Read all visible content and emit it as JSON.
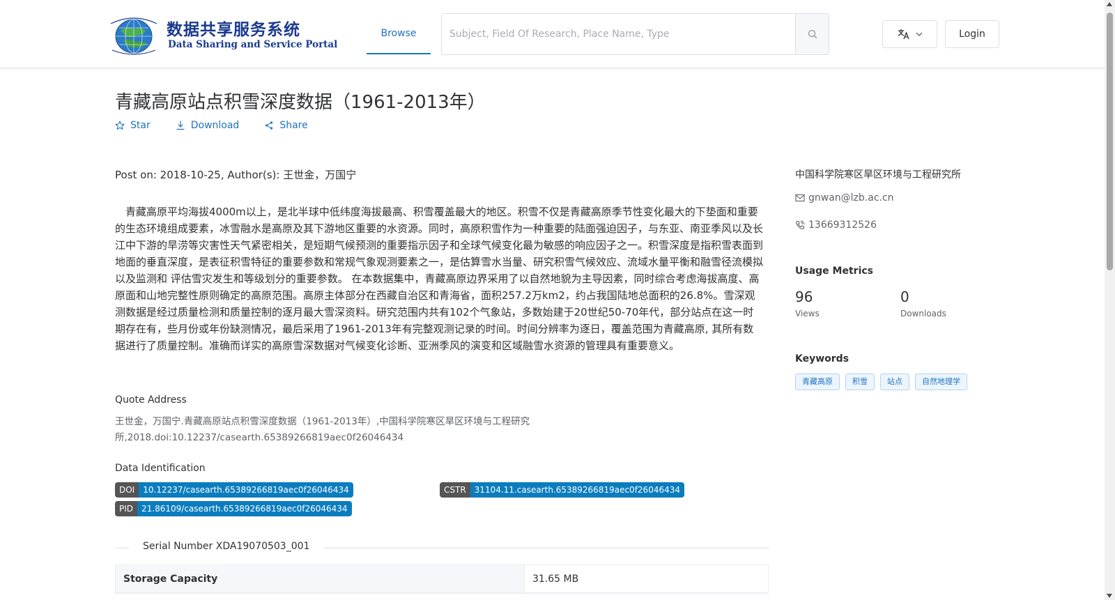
{
  "header": {
    "logo_cn": "数据共享服务系统",
    "logo_en": "Data Sharing and Service Portal",
    "nav_browse": "Browse",
    "search_placeholder": "Subject, Field Of Research, Place Name, Type",
    "login_label": "Login"
  },
  "dataset": {
    "title": "青藏高原站点积雪深度数据（1961-2013年）",
    "actions": {
      "star": "Star",
      "download": "Download",
      "share": "Share"
    },
    "post_info": "Post on: 2018-10-25, Author(s): 王世金，万国宁",
    "description": "青藏高原平均海拔4000m以上，是北半球中低纬度海拔最高、积雪覆盖最大的地区。积雪不仅是青藏高原季节性变化最大的下垫面和重要的生态环境组成要素，冰雪融水是高原及其下游地区重要的水资源。同时，高原积雪作为一种重要的陆面强迫因子，与东亚、南亚季风以及长江中下游的旱涝等灾害性天气紧密相关，是短期气候预测的重要指示因子和全球气候变化最为敏感的响应因子之一。积雪深度是指积雪表面到地面的垂直深度，是表征积雪特征的重要参数和常规气象观测要素之一，是估算雪水当量、研究积雪气候效应、流域水量平衡和融雪径流模拟以及监测和 评估雪灾发生和等级划分的重要参数。 在本数据集中，青藏高原边界采用了以自然地貌为主导因素，同时综合考虑海拔高度、高原面和山地完整性原则确定的高原范围。高原主体部分在西藏自治区和青海省，面积257.2万km2，约占我国陆地总面积的26.8%。雪深观测数据是经过质量检测和质量控制的逐月最大雪深资料。研究范围内共有102个气象站，多数始建于20世纪50-70年代，部分站点在这一时期存在有，些月份或年份缺测情况，最后采用了1961-2013年有完整观测记录的时间。时间分辨率为逐日，覆盖范围为青藏高原, 其所有数据进行了质量控制。准确而详实的高原雪深数据对气候变化诊断、亚洲季风的演变和区域融雪水资源的管理具有重要意义。",
    "quote_label": "Quote Address",
    "quote_text": "王世金，万国宁.青藏高原站点积雪深度数据（1961-2013年）,中国科学院寒区旱区环境与工程研究所,2018.doi:10.12237/casearth.65389266819aec0f26046434",
    "data_id_label": "Data Identification",
    "identifiers": {
      "doi_key": "DOI",
      "doi_value": "10.12237/casearth.65389266819aec0f26046434",
      "cstr_key": "CSTR",
      "cstr_value": "31104.11.casearth.65389266819aec0f26046434",
      "pid_key": "PID",
      "pid_value": "21.86109/casearth.65389266819aec0f26046434"
    },
    "serial_number": "Serial Number XDA19070503_001",
    "table": [
      {
        "key": "Storage Capacity",
        "value": "31.65 MB"
      }
    ]
  },
  "sidebar": {
    "organization": "中国科学院寒区旱区环境与工程研究所",
    "email": "gnwan@lzb.ac.cn",
    "phone": "13669312526",
    "usage_title": "Usage Metrics",
    "views_count": "96",
    "views_label": "Views",
    "downloads_count": "0",
    "downloads_label": "Downloads",
    "keywords_title": "Keywords",
    "keywords": [
      "青藏高原",
      "积雪",
      "站点",
      "自然地理学"
    ]
  },
  "colors": {
    "accent": "#1e73be",
    "badge_key": "#555555",
    "badge_value": "#0b7dbf",
    "logo_text": "#1a3a8f"
  },
  "icons": {
    "star": "star-icon",
    "download": "download-icon",
    "share": "share-icon",
    "search": "search-icon",
    "language": "translate-icon",
    "email": "mail-icon",
    "phone": "phone-icon"
  }
}
